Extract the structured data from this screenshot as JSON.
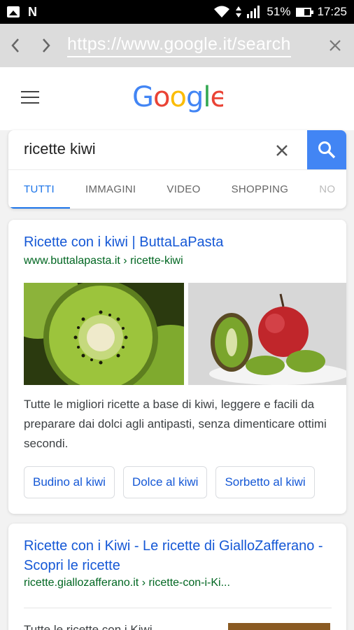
{
  "status_bar": {
    "battery": "51%",
    "battery_level": 0.51,
    "time": "17:25"
  },
  "browser": {
    "url": "https://www.google.it/search"
  },
  "search": {
    "query": "ricette kiwi"
  },
  "tabs": [
    {
      "label": "TUTTI",
      "active": true
    },
    {
      "label": "IMMAGINI"
    },
    {
      "label": "VIDEO"
    },
    {
      "label": "SHOPPING"
    },
    {
      "label": "NO"
    }
  ],
  "results": [
    {
      "title": "Ricette con i kiwi | ButtaLaPasta",
      "url": "www.buttalapasta.it › ricette-kiwi",
      "snippet": "Tutte le migliori ricette a base di kiwi, leggere e facili da preparare dai dolci agli antipasti, senza dimenticare ottimi secondi.",
      "chips": [
        "Budino al kiwi",
        "Dolce al kiwi",
        "Sorbetto al kiwi"
      ]
    },
    {
      "title": "Ricette con i Kiwi - Le ricette di GialloZafferano - Scopri le ricette",
      "url": "ricette.giallozafferano.it › ricette-con-i-Ki...",
      "snippet": "Tutte le ricette con i Kiwi"
    }
  ],
  "colors": {
    "accent": "#1a73e8",
    "link": "#1558d6",
    "url_green": "#006621",
    "search_button": "#4285f4"
  }
}
